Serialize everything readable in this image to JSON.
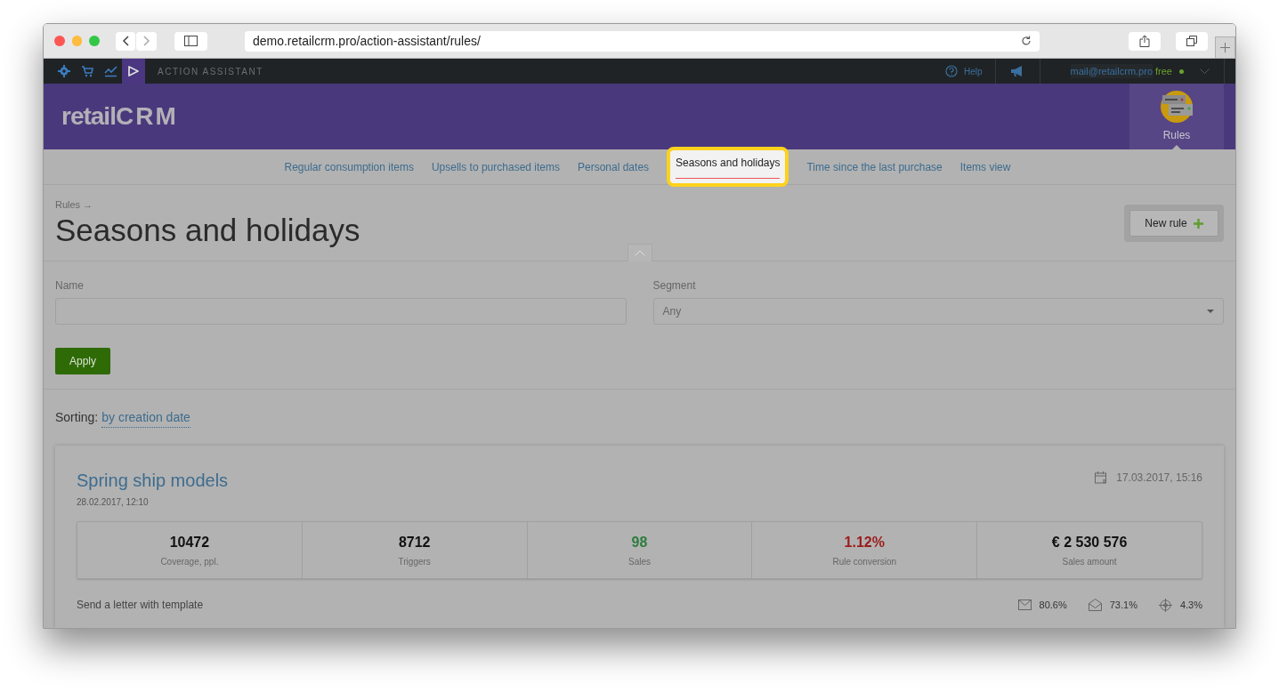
{
  "browser": {
    "url": "demo.retailcrm.pro/action-assistant/rules/"
  },
  "topbar": {
    "section": "ACTION ASSISTANT",
    "help": "Help",
    "email": "mail@retailcrm.pro",
    "plan": "free",
    "online": true,
    "icons": [
      {
        "kind": "gear",
        "selected": false
      },
      {
        "kind": "cart",
        "selected": false
      },
      {
        "kind": "chart",
        "selected": false
      },
      {
        "kind": "play",
        "selected": true
      }
    ]
  },
  "header": {
    "logo_text": "retail",
    "logo_mark": "CRM",
    "module": "Rules"
  },
  "tabs": [
    {
      "label": "Regular consumption items",
      "selected": false
    },
    {
      "label": "Upsells to purchased items",
      "selected": false
    },
    {
      "label": "Personal dates",
      "selected": false
    },
    {
      "label": "Seasons and holidays",
      "selected": true
    },
    {
      "label": "Time since the last purchase",
      "selected": false
    },
    {
      "label": "Items view",
      "selected": false
    }
  ],
  "breadcrumb": "Rules →",
  "title": "Seasons and holidays",
  "new_rule": "New rule",
  "filters": {
    "name_label": "Name",
    "segment_label": "Segment",
    "segment_value": "Any",
    "apply": "Apply"
  },
  "sorting": {
    "label": "Sorting:",
    "value": "by creation date"
  },
  "rule": {
    "name": "Spring ship models",
    "created": "28.02.2017, 12:10",
    "scheduled": "17.03.2017, 15:16",
    "stats": [
      {
        "value": "10472",
        "label": "Coverage, ppl.",
        "color": "#111111"
      },
      {
        "value": "8712",
        "label": "Triggers",
        "color": "#111111"
      },
      {
        "value": "98",
        "label": "Sales",
        "color": "#2e7d3e"
      },
      {
        "value": "1.12%",
        "label": "Rule conversion",
        "color": "#9b1b1b"
      },
      {
        "value": "€ 2 530 576",
        "label": "Sales amount",
        "color": "#111111"
      }
    ],
    "action": "Send a letter with template",
    "metrics": [
      {
        "kind": "sent",
        "value": "80.6%"
      },
      {
        "kind": "opened",
        "value": "73.1%"
      },
      {
        "kind": "clicked",
        "value": "4.3%"
      }
    ]
  }
}
